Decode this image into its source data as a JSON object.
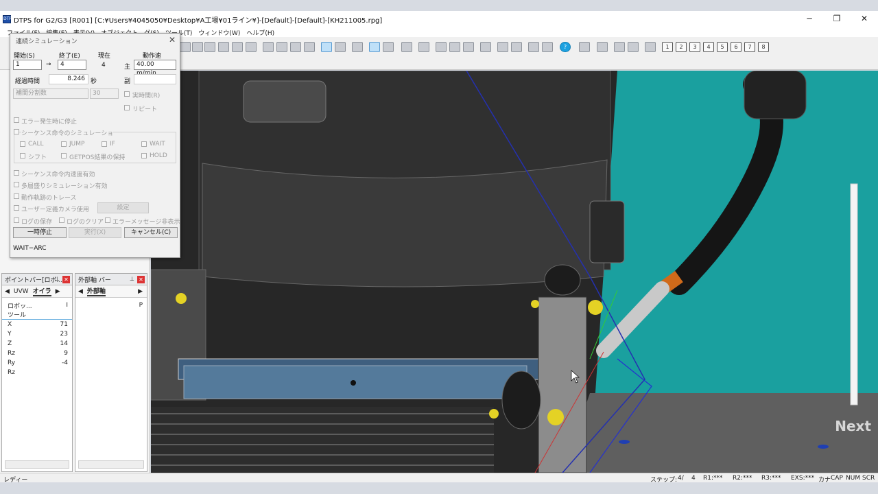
{
  "window": {
    "title": "DTPS for G2/G3 [R001] [C:¥Users¥4045050¥Desktop¥A工場¥01ライン¥]-[Default]-[Default]-[KH211005.rpg]",
    "icon_text": "DTPS",
    "min": "─",
    "restore": "❐",
    "close": "✕"
  },
  "menu": [
    {
      "label": "ファイル(F)"
    },
    {
      "label": "編集(E)"
    },
    {
      "label": "表示(V)"
    },
    {
      "label": "オブジェクト"
    },
    {
      "label": "グ(S)"
    },
    {
      "label": "ツール(T)"
    },
    {
      "label": "ウィンドウ(W)"
    },
    {
      "label": "ヘルプ(H)"
    }
  ],
  "toolbar": {
    "numbers": [
      "1",
      "2",
      "3",
      "4",
      "5",
      "6",
      "7",
      "8"
    ],
    "help": "?"
  },
  "sim": {
    "title": "連続シミュレーション",
    "close": "✕",
    "start_label": "開始(S)",
    "end_label": "終了(E)",
    "current_label": "現在",
    "speed_label": "動作速",
    "start_value": "1",
    "arrow": "→",
    "end_value": "4",
    "current_value": "4",
    "main_label": "主",
    "speed_value": "40.00 m/min",
    "sub_label": "副",
    "elapsed_label": "経過時間",
    "elapsed_value": "8.246",
    "elapsed_unit": "秒",
    "interp_label": "補間分割数",
    "interp_value": "30",
    "realtime_label": "実時間(R)",
    "repeat_label": "リピート",
    "stop_on_error": "エラー発生時に停止",
    "seq_group": "シーケンス命令のシミュレーショ",
    "call": "CALL",
    "jump": "JUMP",
    "if": "IF",
    "wait": "WAIT",
    "shift": "シフト",
    "getpos": "GETPOS結果の保持",
    "hold": "HOLD",
    "seq_speed": "シーケンス命令内速度有効",
    "multilayer": "多層盛りシミュレーション有効",
    "trace": "動作軌跡のトレース",
    "user_camera": "ユーザー定義カメラ使用",
    "settings": "設定",
    "log_save": "ログの保存",
    "log_clear": "ログのクリア",
    "err_hide": "エラーメッセージ非表示",
    "pause": "一時停止",
    "run": "実行(X)",
    "cancel": "キャンセル(C)",
    "status": "WAIT−ARC"
  },
  "point_bar": {
    "title": "ポイントバー[ロボ...",
    "tab1": "UVW",
    "tab2": "オイラ",
    "rows": [
      {
        "k": "ロボッ...",
        "v": "I"
      },
      {
        "k": "ツール",
        "v": ""
      },
      {
        "k": "X",
        "v": "71"
      },
      {
        "k": "Y",
        "v": "23"
      },
      {
        "k": "Z",
        "v": "14"
      },
      {
        "k": "Rz",
        "v": "9"
      },
      {
        "k": "Ry",
        "v": "-4"
      },
      {
        "k": "Rz",
        "v": ""
      }
    ]
  },
  "ext_bar": {
    "title": "外部軸 バー",
    "tab": "外部軸",
    "col": "P"
  },
  "status": {
    "ready": "レディー",
    "step_label": "ステップ:",
    "step": "4/",
    "step_total": "4",
    "r1": "R1:***",
    "r2": "R2:***",
    "r3": "R3:***",
    "exs": "EXS:***",
    "kana": "カナ",
    "cap": "CAP",
    "num": "NUM",
    "scr": "SCR"
  },
  "viewport": {
    "watermark": "Next"
  }
}
